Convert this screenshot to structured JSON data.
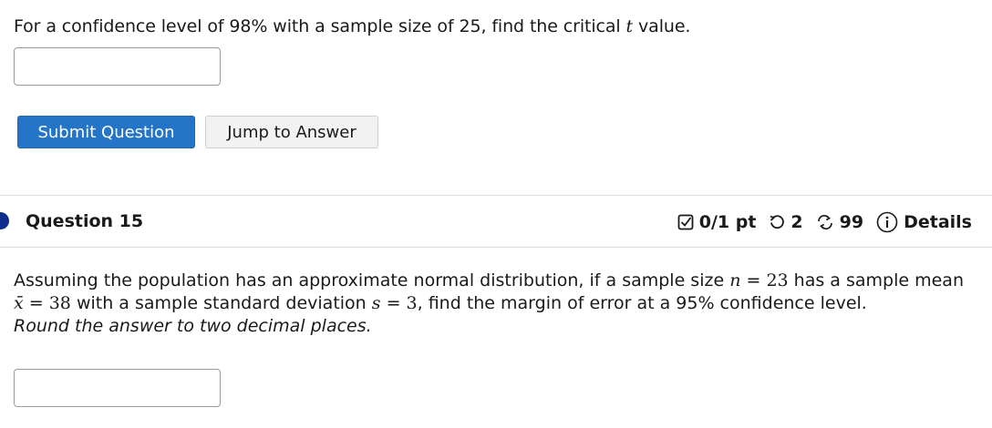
{
  "question14": {
    "text_before": "For a confidence level of 98% with a sample size of 25, find the critical ",
    "var": "t",
    "text_after": " value.",
    "answer_value": "",
    "submit_label": "Submit Question",
    "jump_label": "Jump to Answer"
  },
  "question15": {
    "title": "Question 15",
    "points": "0/1 pt",
    "retries": "2",
    "attempts": "99",
    "details_label": "Details",
    "text": {
      "p1": "Assuming the population has an approximate normal distribution, if a sample size ",
      "n_var": "n",
      "n_eq": " = 23",
      "p2": " has a sample mean ",
      "xbar_var": "x̄",
      "xbar_eq": " = 38",
      "p3": " with a sample standard deviation ",
      "s_var": "s",
      "s_eq": " = 3",
      "p4": ", find the margin of error at a 95% confidence level.",
      "instruction": "Round the answer to two decimal places."
    },
    "answer_value": ""
  },
  "colors": {
    "primary_button": "#2474c7",
    "question_dot": "#0d2e8c",
    "divider": "#dcdcdc"
  },
  "icons": {
    "points": "checkbox-icon",
    "retries": "retry-icon",
    "attempts": "attempts-icon",
    "details": "info-icon"
  }
}
